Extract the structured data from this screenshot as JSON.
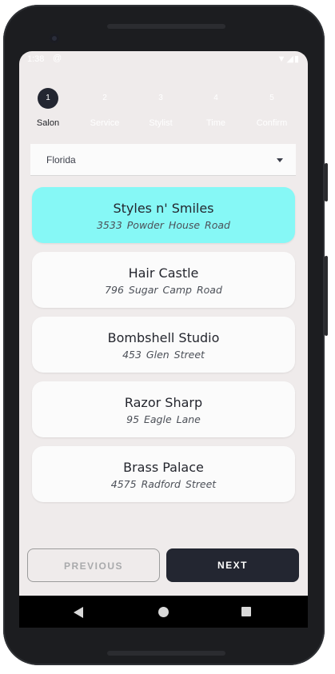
{
  "status_bar": {
    "time": "1:38",
    "notification_icon": "at-sign-icon",
    "right_icons": "▼◢▮"
  },
  "stepper": {
    "steps": [
      {
        "number": "1",
        "label": "Salon",
        "state": "active"
      },
      {
        "number": "2",
        "label": "Service",
        "state": "inactive"
      },
      {
        "number": "3",
        "label": "Stylist",
        "state": "inactive"
      },
      {
        "number": "4",
        "label": "Time",
        "state": "inactive"
      },
      {
        "number": "5",
        "label": "Confirm",
        "state": "inactive"
      }
    ]
  },
  "location_select": {
    "value": "Florida"
  },
  "salons": [
    {
      "name": "Styles n' Smiles",
      "address": "3533  Powder House Road",
      "selected": true
    },
    {
      "name": "Hair Castle",
      "address": "796  Sugar Camp Road",
      "selected": false
    },
    {
      "name": "Bombshell Studio",
      "address": "453  Glen Street",
      "selected": false
    },
    {
      "name": "Razor Sharp",
      "address": "95  Eagle Lane",
      "selected": false
    },
    {
      "name": "Brass Palace",
      "address": "4575  Radford Street",
      "selected": false
    }
  ],
  "buttons": {
    "previous_label": "PREVIOUS",
    "next_label": "NEXT"
  },
  "colors": {
    "selected_card": "#86f8f6",
    "primary_dark": "#232631",
    "background": "#efebeb"
  },
  "navigation_bar": {
    "back_icon": "back-triangle-icon",
    "home_icon": "home-circle-icon",
    "recents_icon": "recents-square-icon"
  }
}
